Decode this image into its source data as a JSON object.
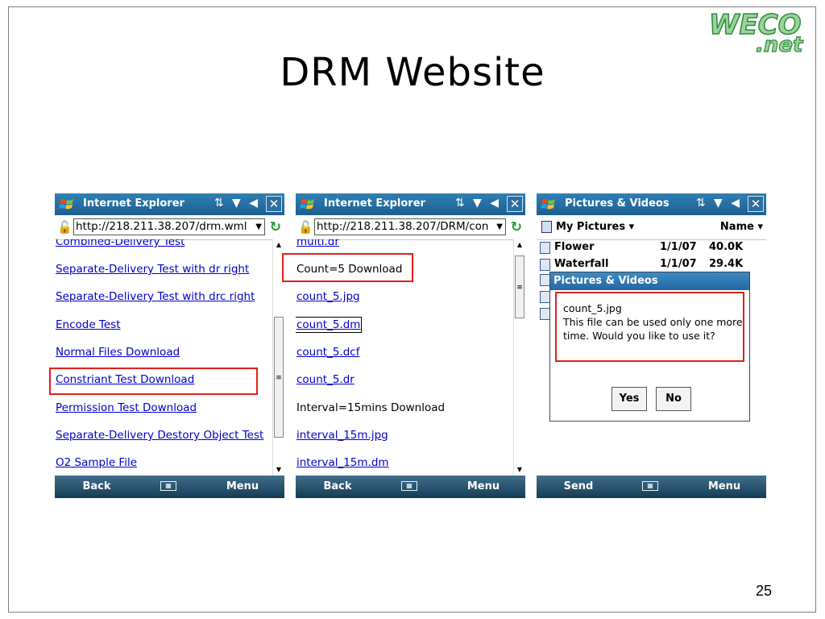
{
  "slide": {
    "title": "DRM Website",
    "number": "25",
    "logo": {
      "top": "WECO",
      "bottom": ".net"
    }
  },
  "status_icons": "⇅ ▼ ◀",
  "screen1": {
    "app_title": "Internet Explorer",
    "url": "http://218.211.38.207/drm.wml",
    "links": [
      "Combined-Delivery Test",
      "Separate-Delivery Test with dr right",
      "Separate-Delivery Test with drc right",
      "Encode Test",
      "Normal Files Download",
      "Constriant Test Download",
      "Permission Test Download",
      "Separate-Delivery Destory Object Test",
      "O2 Sample File"
    ],
    "softkeys": {
      "left": "Back",
      "right": "Menu"
    }
  },
  "screen2": {
    "app_title": "Internet Explorer",
    "url": "http://218.211.38.207/DRM/con",
    "items": [
      {
        "text": "multi.dr",
        "type": "link"
      },
      {
        "text": "Count=5 Download",
        "type": "text"
      },
      {
        "text": "count_5.jpg",
        "type": "link"
      },
      {
        "text": "count_5.dm",
        "type": "link"
      },
      {
        "text": "count_5.dcf",
        "type": "link"
      },
      {
        "text": "count_5.dr",
        "type": "link"
      },
      {
        "text": "Interval=15mins Download",
        "type": "text"
      },
      {
        "text": "interval_15m.jpg",
        "type": "link"
      },
      {
        "text": "interval_15m.dm",
        "type": "link"
      }
    ],
    "softkeys": {
      "left": "Back",
      "right": "Menu"
    }
  },
  "screen3": {
    "app_title": "Pictures & Videos",
    "folder": "My Pictures",
    "sort": "Name",
    "files": [
      {
        "name": "Flower",
        "date": "1/1/07",
        "size": "40.0K"
      },
      {
        "name": "Waterfall",
        "date": "1/1/07",
        "size": "29.4K"
      }
    ],
    "dialog": {
      "title": "Pictures & Videos",
      "filename": "count_5.jpg",
      "message": "This file can be used only one more time. Would you like to use it?",
      "yes": "Yes",
      "no": "No"
    },
    "softkeys": {
      "left": "Send",
      "right": "Menu"
    }
  }
}
